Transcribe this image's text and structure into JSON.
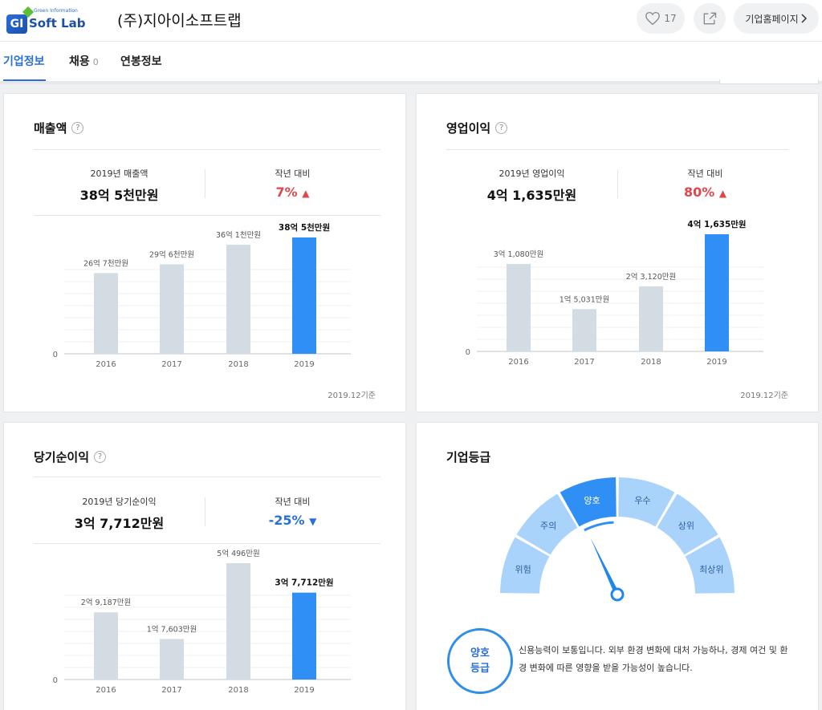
{
  "header": {
    "logo_sub": "Green Information",
    "logo_name": "Soft Lab",
    "company_name": "(주)지아이소프트랩",
    "like_count": "17",
    "homepage_label": "기업홈페이지",
    "icons": [
      "heart-icon",
      "share-icon",
      "chevron-right-icon"
    ]
  },
  "tabs": [
    {
      "label": "기업정보",
      "active": true
    },
    {
      "label": "채용",
      "count": "0"
    },
    {
      "label": "연봉정보"
    }
  ],
  "colors": {
    "accent": "#2a6fd8",
    "bar_gray": "#d3dbe3",
    "bar_highlight": "#2f8ff5",
    "up": "#e0474c",
    "down": "#2a6fd8"
  },
  "revenue": {
    "title": "매출액",
    "stat_label": "2019년 매출액",
    "stat_value": "38억 5천만원",
    "change_label": "작년 대비",
    "change_value": "7%",
    "change_icon": "▲",
    "footnote": "2019.12기준"
  },
  "operating": {
    "title": "영업이익",
    "stat_label": "2019년 영업이익",
    "stat_value": "4억 1,635만원",
    "change_label": "작년 대비",
    "change_value": "80%",
    "change_icon": "▲",
    "footnote": "2019.12기준"
  },
  "netincome": {
    "title": "당기순이익",
    "stat_label": "2019년 당기순이익",
    "stat_value": "3억 7,712만원",
    "change_label": "작년 대비",
    "change_value": "-25%",
    "change_icon": "▼"
  },
  "grade": {
    "title": "기업등급",
    "segments": [
      "위험",
      "주의",
      "양호",
      "우수",
      "상위",
      "최상위"
    ],
    "current": "양호",
    "badge_top": "양호",
    "badge_bottom": "등급",
    "description": "신용능력이 보통입니다. 외부 환경 변화에 대처 가능하나, 경제 여건 및 환경 변화에 따른 영향을 받을 가능성이 높습니다."
  },
  "chart_data": [
    {
      "type": "bar",
      "categories": [
        "2016",
        "2017",
        "2018",
        "2019"
      ],
      "values": [
        26.7,
        29.6,
        36.1,
        38.5
      ],
      "labels": [
        "26억 7천만원",
        "29억 6천만원",
        "36억 1천만원",
        "38억 5천만원"
      ],
      "zero_label": "0",
      "highlight_index": 3
    },
    {
      "type": "bar",
      "categories": [
        "2016",
        "2017",
        "2018",
        "2019"
      ],
      "values": [
        3.108,
        1.5031,
        2.312,
        4.1635
      ],
      "labels": [
        "3억 1,080만원",
        "1억 5,031만원",
        "2억 3,120만원",
        "4억 1,635만원"
      ],
      "zero_label": "0",
      "highlight_index": 3
    },
    {
      "type": "bar",
      "categories": [
        "2016",
        "2017",
        "2018",
        "2019"
      ],
      "values": [
        2.9187,
        1.7603,
        5.0496,
        3.7712
      ],
      "labels": [
        "2억 9,187만원",
        "1억 7,603만원",
        "5억 496만원",
        "3억 7,712만원"
      ],
      "zero_label": "0",
      "highlight_index": 3
    }
  ]
}
